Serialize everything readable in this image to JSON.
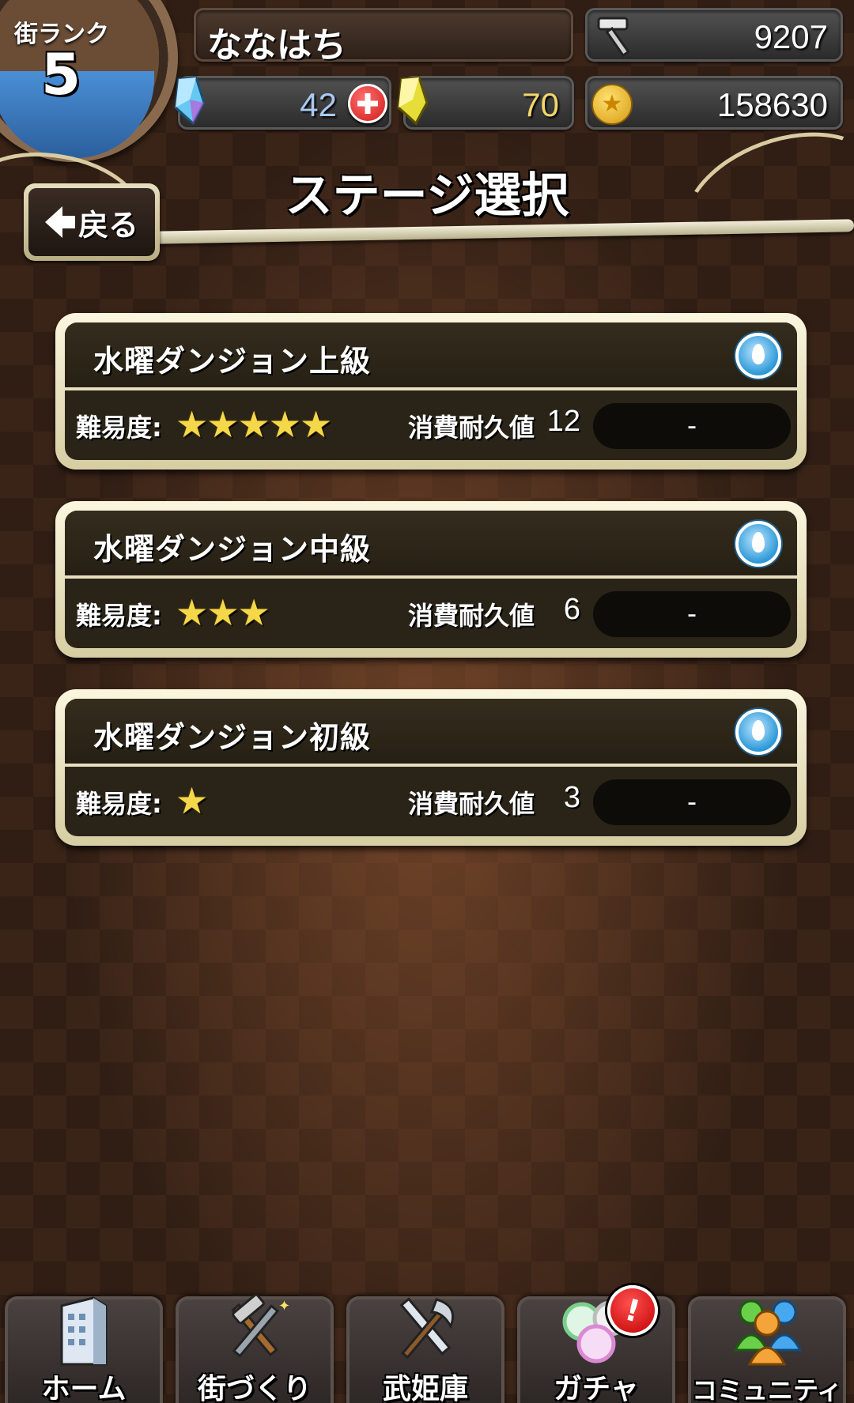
{
  "header": {
    "rank_label": "街ランク",
    "rank_value": "5",
    "player_name": "ななはち",
    "hammer_value": "9207",
    "blue_crystal_value": "42",
    "yellow_crystal_value": "70",
    "coin_value": "158630"
  },
  "page": {
    "title": "ステージ選択",
    "back_label": "戻る"
  },
  "stages": [
    {
      "name": "水曜ダンジョン上級",
      "difficulty_label": "難易度:",
      "stars": 5,
      "stars_text": "★★★★★",
      "cost_label": "消費耐久値",
      "cost_value": "12",
      "status": "-"
    },
    {
      "name": "水曜ダンジョン中級",
      "difficulty_label": "難易度:",
      "stars": 3,
      "stars_text": "★★★",
      "cost_label": "消費耐久値",
      "cost_value": "6",
      "status": "-"
    },
    {
      "name": "水曜ダンジョン初級",
      "difficulty_label": "難易度:",
      "stars": 1,
      "stars_text": "★",
      "cost_label": "消費耐久値",
      "cost_value": "3",
      "status": "-"
    }
  ],
  "nav": {
    "items": [
      {
        "label": "ホーム",
        "icon": "building-icon"
      },
      {
        "label": "街づくり",
        "icon": "tools-icon"
      },
      {
        "label": "武姫庫",
        "icon": "weapons-icon"
      },
      {
        "label": "ガチャ",
        "icon": "gacha-orbs-icon"
      },
      {
        "label": "コミュニティ",
        "icon": "people-icon"
      }
    ],
    "alert_symbol": "!"
  },
  "colors": {
    "accent_star": "#f5d84a",
    "card_frame": "#fbf7df",
    "card_body": "#2a2418",
    "alert_red": "#c00000"
  }
}
